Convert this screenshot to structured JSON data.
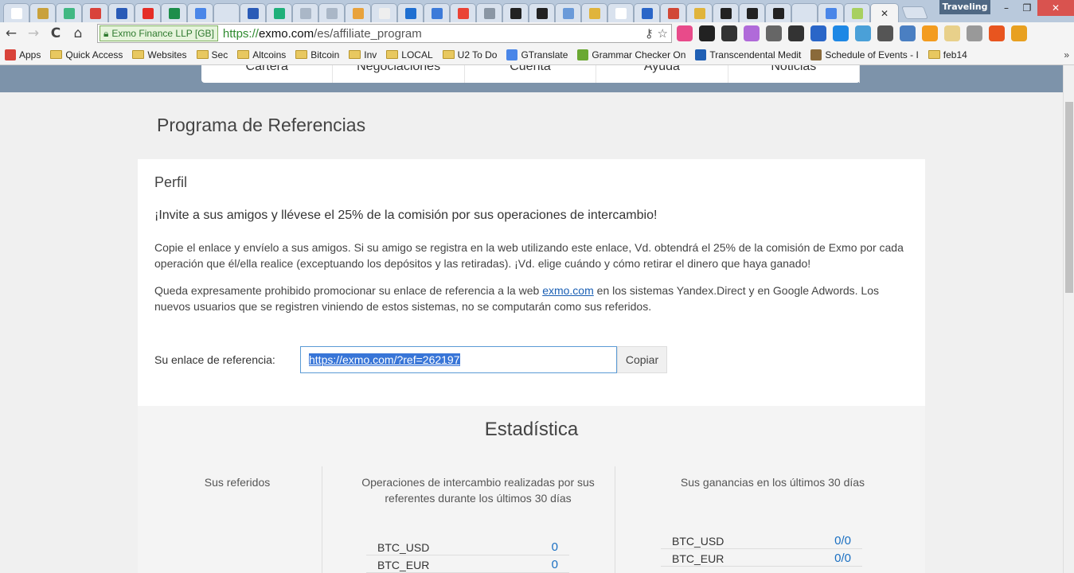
{
  "browser": {
    "tabs": [
      {
        "icon": "document-icon",
        "color": "#ffffff"
      },
      {
        "icon": "books-icon",
        "color": "#c9a13c"
      },
      {
        "icon": "vue-icon",
        "color": "#41b883"
      },
      {
        "icon": "maps-icon",
        "color": "#d9433a"
      },
      {
        "icon": "ethereum-icon",
        "color": "#2a5bb7"
      },
      {
        "icon": "youtube-icon",
        "color": "#e52d27"
      },
      {
        "icon": "sheets-icon",
        "color": "#1e8e4a"
      },
      {
        "icon": "docs-icon",
        "color": "#4a86e8"
      },
      {
        "icon": "blank-icon",
        "color": "#d9e2ee"
      },
      {
        "icon": "ethereum-icon",
        "color": "#2a5bb7"
      },
      {
        "icon": "medium-icon",
        "color": "#1fb07a"
      },
      {
        "icon": "network-icon",
        "color": "#aab7c7"
      },
      {
        "icon": "network-icon",
        "color": "#aab7c7"
      },
      {
        "icon": "bitcoin-bar-icon",
        "color": "#e8a23c"
      },
      {
        "icon": "wikipedia-icon",
        "color": "#eeeeee"
      },
      {
        "icon": "d-icon",
        "color": "#1f6fd1"
      },
      {
        "icon": "bitcoin-shield-icon",
        "color": "#3d7bd9"
      },
      {
        "icon": "google-icon",
        "color": "#ea4335"
      },
      {
        "icon": "brain-icon",
        "color": "#8a96a4"
      },
      {
        "icon": "bc-icon",
        "color": "#222222"
      },
      {
        "icon": "bc-icon",
        "color": "#222222"
      },
      {
        "icon": "wave-icon",
        "color": "#6a9ad9"
      },
      {
        "icon": "grid-icon",
        "color": "#e0b43c"
      },
      {
        "icon": "document-icon",
        "color": "#ffffff"
      },
      {
        "icon": "v-icon",
        "color": "#2a66c8"
      },
      {
        "icon": "gmail-icon",
        "color": "#d14836"
      },
      {
        "icon": "grid-icon",
        "color": "#e0b43c"
      },
      {
        "icon": "tf-icon",
        "color": "#222222"
      },
      {
        "icon": "tf-icon",
        "color": "#222222"
      },
      {
        "icon": "tf-icon",
        "color": "#222222"
      },
      {
        "icon": "blank-icon",
        "color": "#d9e2ee"
      },
      {
        "icon": "docs-icon",
        "color": "#4a86e8"
      },
      {
        "icon": "exmo-icon",
        "color": "#a8d060"
      }
    ],
    "active_tab_close": "✕",
    "profile": "Traveling",
    "window": {
      "minimize": "–",
      "restore": "❐",
      "close": "✕"
    },
    "nav": {
      "back": "←",
      "forward": "→",
      "reload": "C",
      "home": "⌂"
    },
    "ev_cert": "Exmo Finance LLP [GB]",
    "url": {
      "scheme": "https://",
      "host": "exmo.com",
      "path": "/es/affiliate_program"
    },
    "extensions": [
      "#e84b8a",
      "#222222",
      "#333333",
      "#b06ad9",
      "#666666",
      "#333333",
      "#2a66c8",
      "#1e88e5",
      "#4aa0d8",
      "#555555",
      "#4a7fc2",
      "#f39c1f",
      "#e8d08a",
      "#999999",
      "#e8551f",
      "#e8a020"
    ],
    "bookmarks": [
      {
        "label": "Apps",
        "type": "apps",
        "color": "#d9433a"
      },
      {
        "label": "Quick Access",
        "type": "folder"
      },
      {
        "label": "Websites",
        "type": "folder"
      },
      {
        "label": "Sec",
        "type": "folder"
      },
      {
        "label": "Altcoins",
        "type": "folder"
      },
      {
        "label": "Bitcoin",
        "type": "folder"
      },
      {
        "label": "Inv",
        "type": "folder"
      },
      {
        "label": "LOCAL",
        "type": "folder"
      },
      {
        "label": "U2 To Do",
        "type": "folder"
      },
      {
        "label": "GTranslate",
        "type": "site",
        "color": "#4a86e8"
      },
      {
        "label": "Grammar Checker On",
        "type": "site",
        "color": "#6aa832"
      },
      {
        "label": "Transcendental Medit",
        "type": "site",
        "color": "#1f5fb4"
      },
      {
        "label": "Schedule of Events - I",
        "type": "site",
        "color": "#8a6a3a"
      },
      {
        "label": "feb14",
        "type": "folder"
      }
    ],
    "more": "»"
  },
  "site": {
    "nav": [
      "Cartera",
      "Negociaciones",
      "Cuenta",
      "Ayuda",
      "Noticias"
    ],
    "page_title": "Programa de Referencias",
    "profile": {
      "title": "Perfil",
      "invite": "¡Invite a sus amigos y llévese el 25% de la comisión por sus operaciones de intercambio!",
      "para1": "Copie el enlace y envíelo a sus amigos. Si su amigo se registra en la web utilizando este enlace, Vd. obtendrá el 25% de la comisión de Exmo por cada operación que él/ella realice (exceptuando los depósitos y las retiradas). ¡Vd. elige cuándo y cómo retirar el dinero que haya ganado!",
      "para2_before": "Queda expresamente prohibido promocionar su enlace de referencia a la web ",
      "para2_link": "exmo.com",
      "para2_after": " en los sistemas Yandex.Direct y en Google Adwords. Los nuevos usuarios que se registren viniendo de estos sistemas, no se computarán como sus referidos.",
      "ref_label": "Su enlace de referencia:",
      "ref_value": "https://exmo.com/?ref=262197",
      "copy_label": "Copiar"
    },
    "stats": {
      "title": "Estadística",
      "col1": "Sus referidos",
      "col2": "Operaciones de intercambio realizadas por sus referentes durante los últimos 30 días",
      "col3": "Sus ganancias en los últimos 30 días",
      "operations": [
        {
          "pair": "BTC_USD",
          "value": "0"
        },
        {
          "pair": "BTC_EUR",
          "value": "0"
        }
      ],
      "earnings": [
        {
          "pair": "BTC_USD",
          "value": "0/0"
        },
        {
          "pair": "BTC_EUR",
          "value": "0/0"
        }
      ]
    }
  }
}
